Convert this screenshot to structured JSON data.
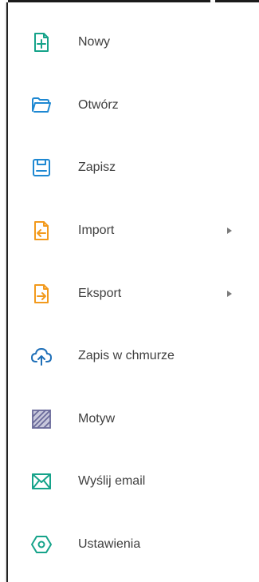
{
  "menu": {
    "items": [
      {
        "label": "Nowy",
        "icon": "new-file-icon",
        "color": "#16a38a"
      },
      {
        "label": "Otwórz",
        "icon": "folder-open-icon",
        "color": "#1e88d2"
      },
      {
        "label": "Zapisz",
        "icon": "save-icon",
        "color": "#1e88d2"
      },
      {
        "label": "Import",
        "icon": "import-icon",
        "color": "#f29a1d",
        "submenu": true
      },
      {
        "label": "Eksport",
        "icon": "export-icon",
        "color": "#f29a1d",
        "submenu": true
      },
      {
        "label": "Zapis w chmurze",
        "icon": "cloud-upload-icon",
        "color": "#1e6fb8"
      },
      {
        "label": "Motyw",
        "icon": "theme-hatch-icon",
        "color": "#6a6a9a"
      },
      {
        "label": "Wyślij email",
        "icon": "email-icon",
        "color": "#16a38a"
      },
      {
        "label": "Ustawienia",
        "icon": "settings-icon",
        "color": "#16a38a"
      }
    ]
  }
}
